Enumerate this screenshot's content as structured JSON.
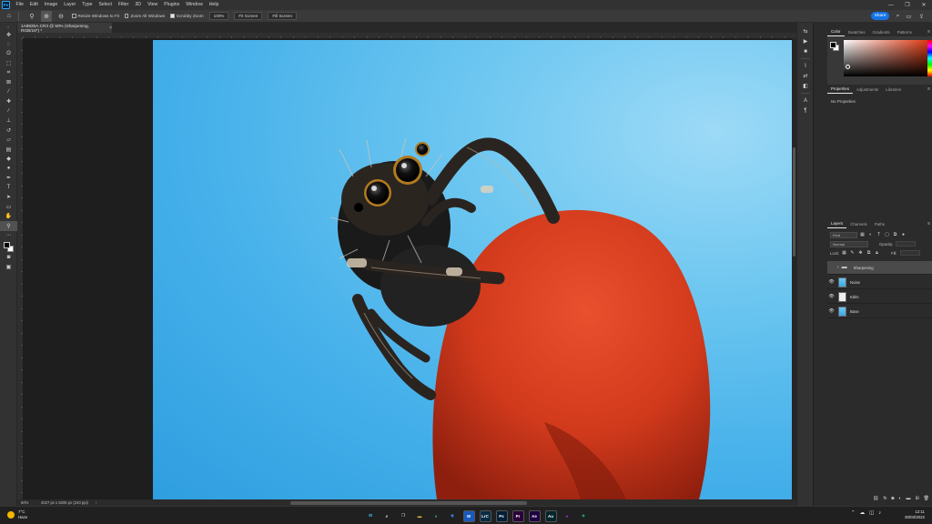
{
  "menubar": {
    "logo": "Ps",
    "items": [
      "File",
      "Edit",
      "Image",
      "Layer",
      "Type",
      "Select",
      "Filter",
      "3D",
      "View",
      "Plugins",
      "Window",
      "Help"
    ],
    "window_controls": [
      "—",
      "❐",
      "✕"
    ]
  },
  "options": {
    "resize_windows_label": "Resize Windows to Fit",
    "zoom_all_label": "Zoom All Windows",
    "scrubby_zoom_label": "Scrubby Zoom",
    "scrubby_zoom_checked": true,
    "zoom_100_label": "100%",
    "fit_screen_label": "Fit Screen",
    "fill_screen_label": "Fill Screen",
    "share_label": "Share"
  },
  "document": {
    "tab_title": "1A8825A.CR3 @ 50% (Sharpening, RGB/16*) *",
    "tab_close": "×"
  },
  "status": {
    "zoom": "50%",
    "dims": "4027 px x 5205 px (240 ppi)",
    "arrow": "›"
  },
  "panels": {
    "color_tabs": [
      "Color",
      "Swatches",
      "Gradients",
      "Patterns"
    ],
    "color": {
      "foreground": "#000000",
      "background": "#ffffff",
      "hue_color": "#e03b14"
    },
    "properties_tabs": [
      "Properties",
      "Adjustments",
      "Libraries"
    ],
    "no_properties": "No Properties",
    "layers_tabs": [
      "Layers",
      "Channels",
      "Paths"
    ],
    "kind_label": "Kind",
    "blend_mode": "Normal",
    "opacity_label": "Opacity:",
    "lock_label": "Lock:",
    "fill_label": "Fill:",
    "layers": [
      {
        "name": "Sharpening",
        "type": "group",
        "visible": false
      },
      {
        "name": "Noise",
        "type": "layer",
        "visible": true
      },
      {
        "name": "Edits",
        "type": "layer",
        "visible": true
      },
      {
        "name": "Base",
        "type": "layer",
        "visible": true
      }
    ],
    "menu_glyph": "≡"
  },
  "taskbar": {
    "weather_temp": "7°C",
    "weather_desc": "Haze",
    "apps": [
      {
        "name": "Start",
        "label": "⊞",
        "color": "#4cc2ff"
      },
      {
        "name": "Search",
        "label": "⌕",
        "color": "#e8e8e8"
      },
      {
        "name": "Task View",
        "label": "❐",
        "color": "#e8e8e8"
      },
      {
        "name": "File Explorer",
        "label": "▬",
        "color": "#f5c542"
      },
      {
        "name": "Edge",
        "label": "e",
        "color": "#2bb673"
      },
      {
        "name": "Chrome",
        "label": "◉",
        "color": "#4285f4"
      },
      {
        "name": "Word",
        "label": "W",
        "color": "#185abd"
      },
      {
        "name": "Lightroom Classic",
        "label": "LrC",
        "color": "#0a2b43"
      },
      {
        "name": "Photoshop",
        "label": "Ps",
        "color": "#001e36"
      },
      {
        "name": "Premiere Pro",
        "label": "Pr",
        "color": "#2a0038"
      },
      {
        "name": "After Effects",
        "label": "Ae",
        "color": "#1f0040"
      },
      {
        "name": "Audition",
        "label": "Au",
        "color": "#00252a"
      },
      {
        "name": "Messenger",
        "label": "●",
        "color": "#a033ff"
      },
      {
        "name": "Other App",
        "label": "◆",
        "color": "#1c9e7e"
      }
    ],
    "tray": [
      "⌃",
      "☁",
      "◫",
      "♪"
    ],
    "time": "12:11",
    "date": "30/03/2022"
  }
}
